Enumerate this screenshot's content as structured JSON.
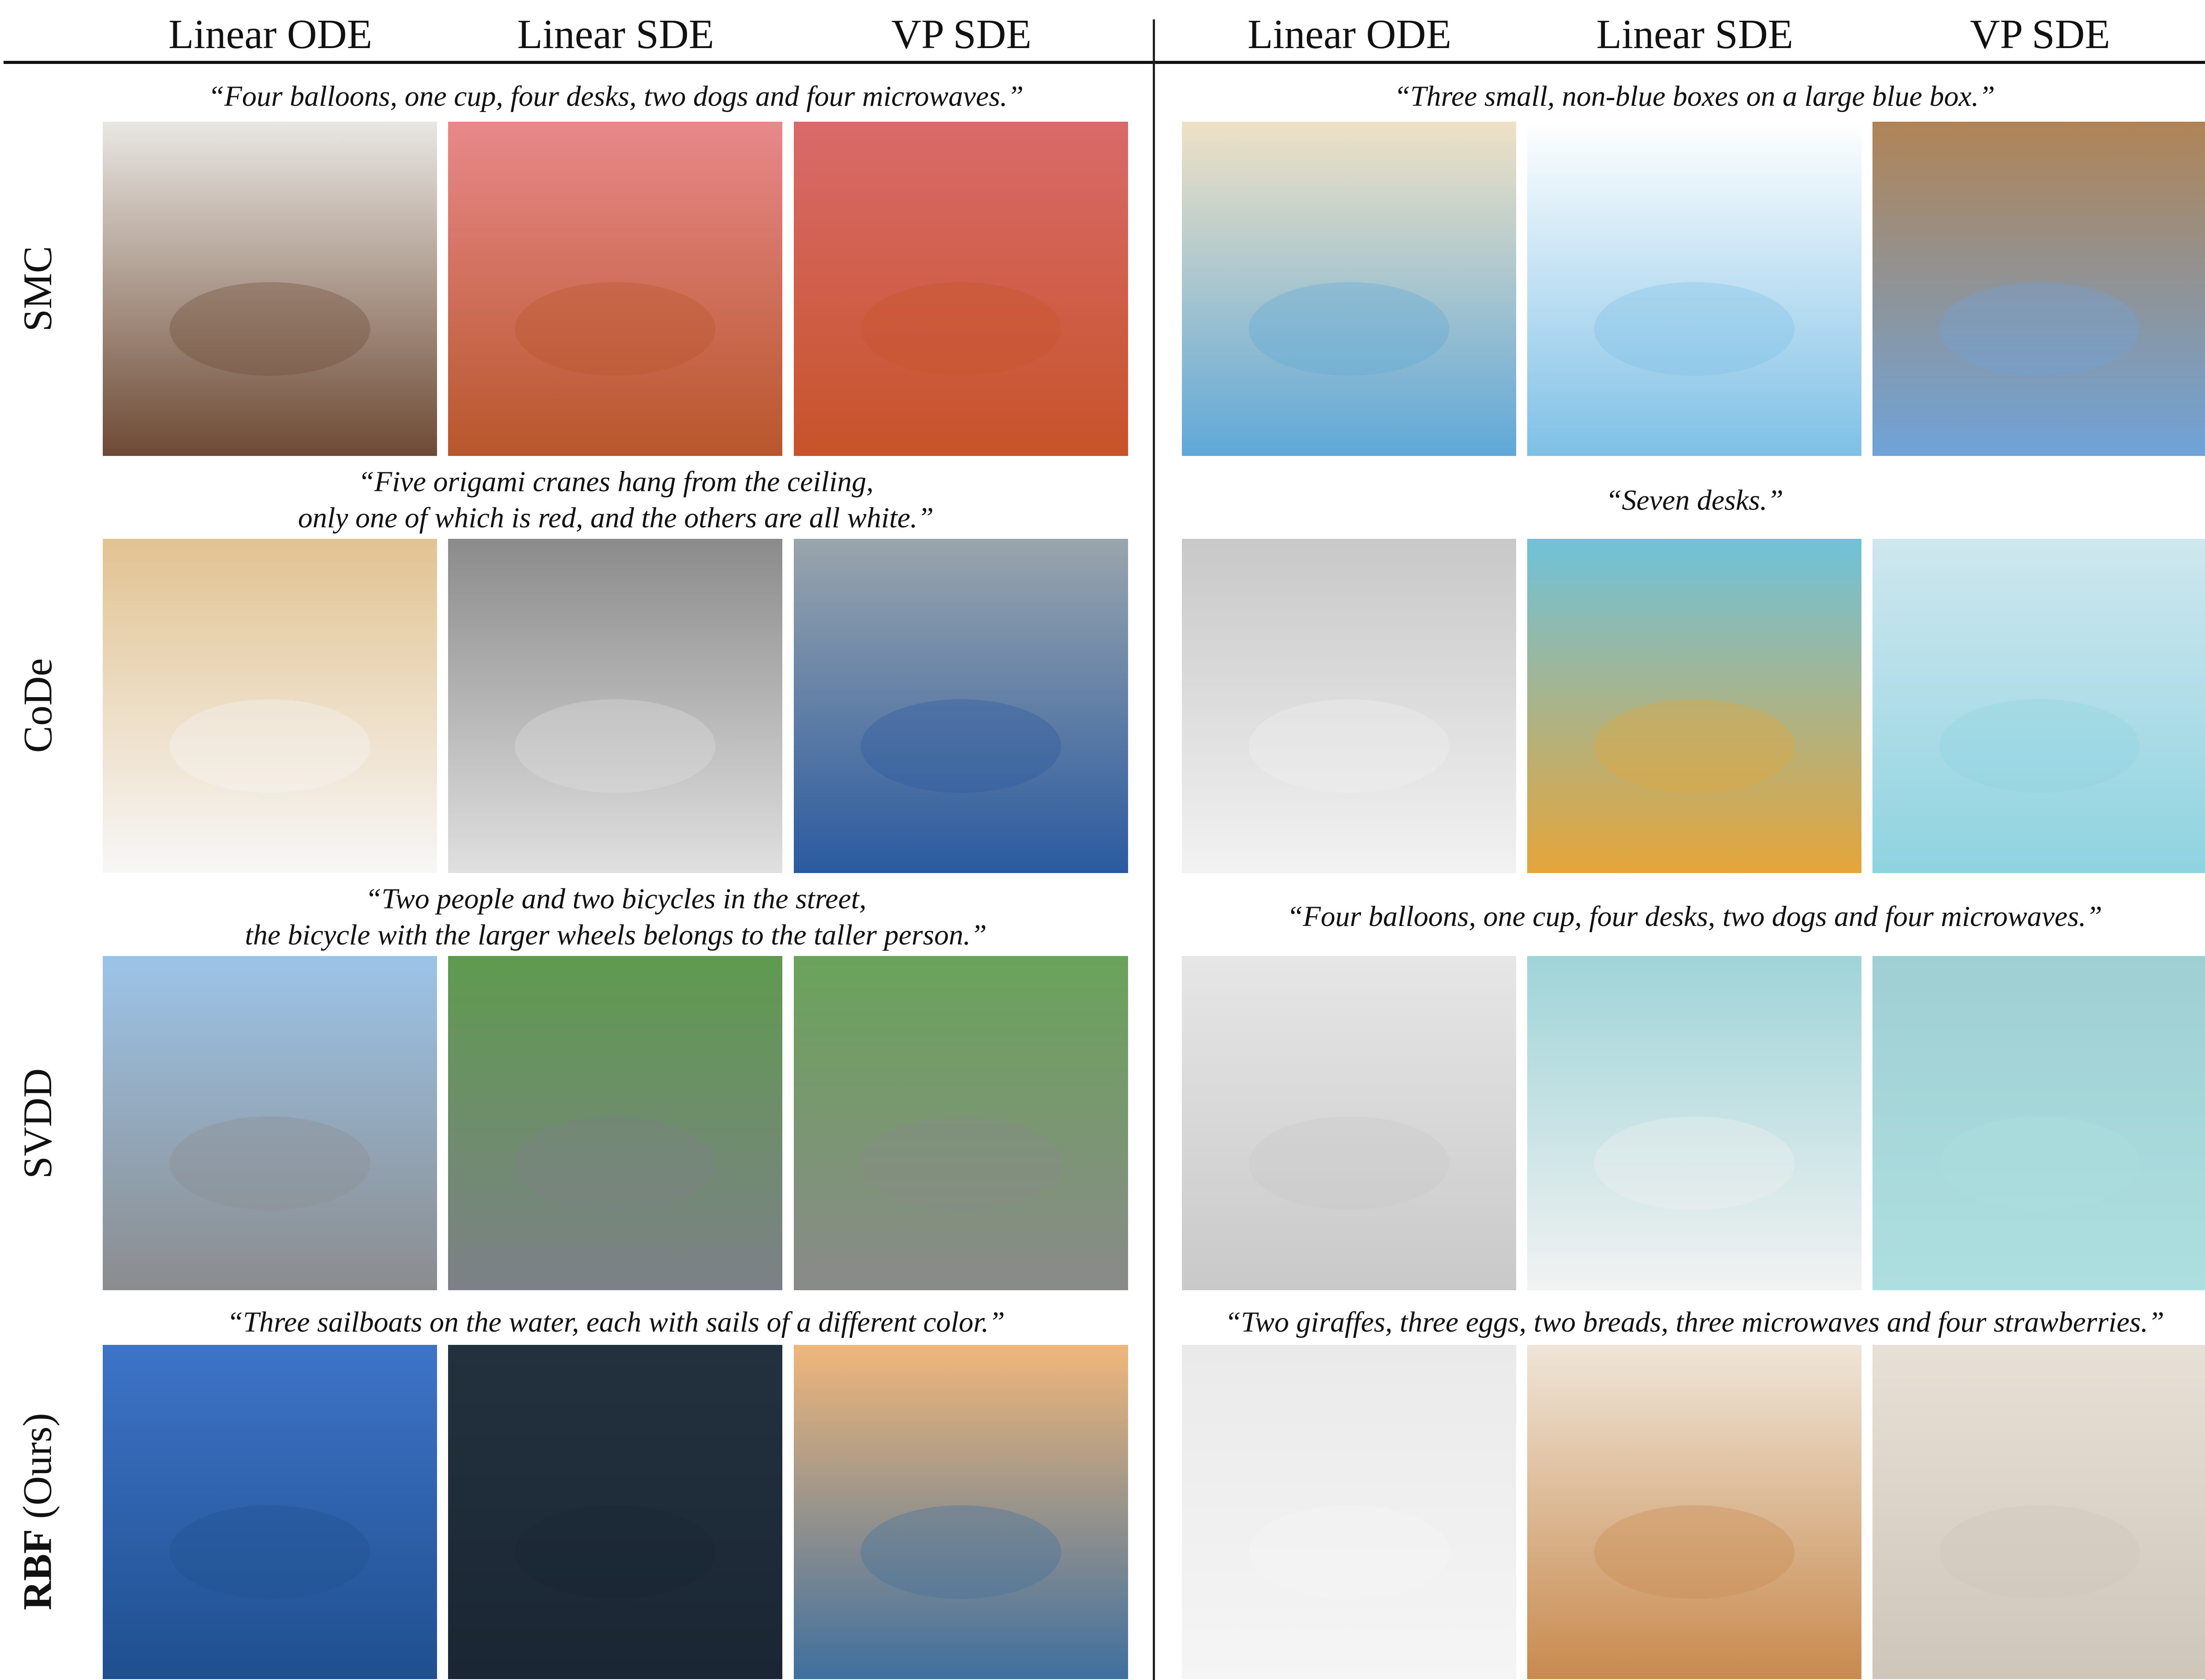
{
  "column_headers": {
    "left": [
      "Linear ODE",
      "Linear SDE",
      "VP SDE"
    ],
    "right": [
      "Linear ODE",
      "Linear SDE",
      "VP SDE"
    ]
  },
  "row_labels": [
    "SMC",
    "CoDe",
    "SVDD"
  ],
  "row_label_ours": {
    "bold": "RBF",
    "rest": " (Ours)"
  },
  "captions": {
    "left": [
      [
        "“Four balloons, one cup, four desks, two dogs and four microwaves.”"
      ],
      [
        "“Five origami cranes hang from the ceiling,",
        "only one of which is red, and the others are all white.”"
      ],
      [
        "“Two people and two bicycles in the street,",
        "the bicycle with the larger wheels belongs to the taller person.”"
      ],
      [
        "“Three sailboats on the water, each with sails of a different color.”"
      ]
    ],
    "right": [
      [
        "“Three small, non-blue boxes on a large blue box.”"
      ],
      [
        "“Seven desks.”"
      ],
      [
        "“Four balloons, one cup, four desks, two dogs and four microwaves.”"
      ],
      [
        "“Two giraffes, three eggs, two breads, three microwaves and four strawberries.”"
      ]
    ]
  },
  "images": [
    [
      "balloons-desk-dogs-image",
      "balloons-pink-wall-image",
      "balloons-orange-desk-image",
      "blue-box-colored-boxes-image",
      "blue-box-white-bg-image",
      "blue-box-wood-floor-image"
    ],
    [
      "origami-cranes-wood-image",
      "origami-cranes-grey-image",
      "origami-cranes-cafe-image",
      "white-desks-room-image",
      "yellow-chairs-blue-image",
      "white-desks-windmill-image"
    ],
    [
      "cyclists-street-image",
      "cyclists-trees-image",
      "cyclists-car-image",
      "balloons-microwaves-dogs-image",
      "balloons-cup-dogs-image",
      "balloons-white-dogs-image"
    ],
    [
      "sailboats-ocean-image",
      "sailboats-aerial-image",
      "sailboats-sunset-image",
      "giraffes-microwave-table-image",
      "giraffes-eggs-breads-image",
      "giraffes-microwaves-eggs-image"
    ]
  ],
  "image_colors": [
    [
      [
        "#e9e7e3",
        "#6e4a35"
      ],
      [
        "#e8888a",
        "#b8562c"
      ],
      [
        "#d96a6a",
        "#c7532a"
      ],
      [
        "#efe2c6",
        "#5fa8d8"
      ],
      [
        "#ffffff",
        "#7ec0e6"
      ],
      [
        "#b08456",
        "#6fa3d9"
      ]
    ],
    [
      [
        "#e2c392",
        "#f7f7f7"
      ],
      [
        "#8b8b8b",
        "#e0e0e0"
      ],
      [
        "#9aa5ad",
        "#2a5aa0"
      ],
      [
        "#c8c8c8",
        "#f2f2f2"
      ],
      [
        "#6fc2d9",
        "#e5a53a"
      ],
      [
        "#cfe7ef",
        "#8fd3e0"
      ]
    ],
    [
      [
        "#9cc4e8",
        "#8b8c8e"
      ],
      [
        "#5f9a4f",
        "#7d8088"
      ],
      [
        "#6aa35a",
        "#8a8a8a"
      ],
      [
        "#e6e6e6",
        "#c9c9c9"
      ],
      [
        "#9fd4d8",
        "#f2f2f2"
      ],
      [
        "#9fcfd3",
        "#aedfe0"
      ]
    ],
    [
      [
        "#3e74c8",
        "#1f4f8f"
      ],
      [
        "#23313e",
        "#1a2633"
      ],
      [
        "#f0b77a",
        "#3e6f9e"
      ],
      [
        "#eaeaea",
        "#f5f5f5"
      ],
      [
        "#efe5d8",
        "#c88a4e"
      ],
      [
        "#e7e0d6",
        "#cfc6ba"
      ]
    ]
  ]
}
